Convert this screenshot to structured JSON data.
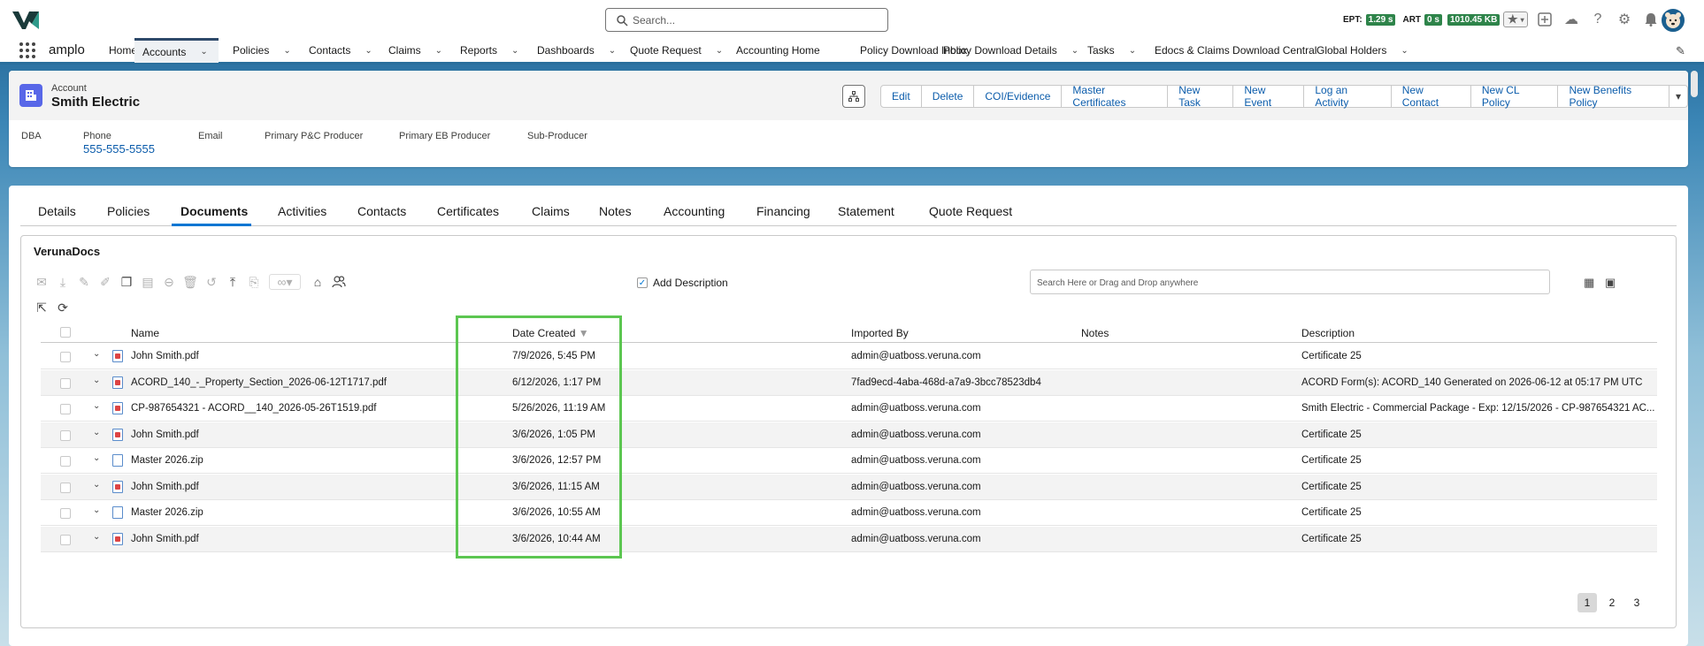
{
  "header": {
    "search_placeholder": "Search...",
    "metrics": [
      {
        "label": "EPT:",
        "value": "1.29 s"
      },
      {
        "label": "ART",
        "value": "0 s"
      },
      {
        "label": "",
        "value": "1010.45 KB"
      }
    ],
    "icons": [
      "plus-icon",
      "cloud-icon",
      "help-icon",
      "gear-icon",
      "bell-icon"
    ]
  },
  "nav": {
    "app_name": "amplo",
    "items": [
      {
        "label": "Home",
        "chevron": false
      },
      {
        "label": "Accounts",
        "chevron": true,
        "active": true
      },
      {
        "label": "Policies",
        "chevron": true
      },
      {
        "label": "Contacts",
        "chevron": true
      },
      {
        "label": "Claims",
        "chevron": true
      },
      {
        "label": "Reports",
        "chevron": true
      },
      {
        "label": "Dashboards",
        "chevron": true
      },
      {
        "label": "Quote Request",
        "chevron": true
      },
      {
        "label": "Accounting Home",
        "chevron": false
      },
      {
        "label": "Policy Download Inbox",
        "chevron": false
      },
      {
        "label": "Policy Download Details",
        "chevron": true
      },
      {
        "label": "Tasks",
        "chevron": true
      },
      {
        "label": "Edocs & Claims Download Central",
        "chevron": false
      },
      {
        "label": "Global Holders",
        "chevron": true
      }
    ]
  },
  "account": {
    "type_label": "Account",
    "name": "Smith Electric",
    "actions": [
      "Edit",
      "Delete",
      "COI/Evidence",
      "Master Certificates",
      "New Task",
      "New Event",
      "Log an Activity",
      "New Contact",
      "New CL Policy",
      "New Benefits Policy"
    ],
    "fields": {
      "dba": "DBA",
      "phone_label": "Phone",
      "phone_value": "555-555-5555",
      "email": "Email",
      "pc_producer": "Primary P&C Producer",
      "eb_producer": "Primary EB Producer",
      "sub_producer": "Sub-Producer"
    }
  },
  "tabs": [
    "Details",
    "Policies",
    "Documents",
    "Activities",
    "Contacts",
    "Certificates",
    "Claims",
    "Notes",
    "Accounting",
    "Financing",
    "Statement",
    "Quote Request"
  ],
  "active_tab": "Documents",
  "docs": {
    "title": "VerunaDocs",
    "add_description_label": "Add Description",
    "add_description_checked": true,
    "search_placeholder": "Search Here or Drag and Drop anywhere",
    "columns": {
      "name": "Name",
      "date_created": "Date Created",
      "imported_by": "Imported By",
      "notes": "Notes",
      "description": "Description"
    },
    "rows": [
      {
        "name": "John Smith.pdf",
        "type": "pdf",
        "date": "7/9/2026, 5:45 PM",
        "imported_by": "admin@uatboss.veruna.com",
        "notes": "",
        "description": "Certificate 25"
      },
      {
        "name": "ACORD_140_-_Property_Section_2026-06-12T1717.pdf",
        "type": "pdf",
        "date": "6/12/2026, 1:17 PM",
        "imported_by": "7fad9ecd-4aba-468d-a7a9-3bcc78523db4",
        "notes": "",
        "description": "ACORD Form(s): ACORD_140 Generated on 2026-06-12 at 05:17 PM UTC"
      },
      {
        "name": "CP-987654321 - ACORD__140_2026-05-26T1519.pdf",
        "type": "pdf",
        "date": "5/26/2026, 11:19 AM",
        "imported_by": "admin@uatboss.veruna.com",
        "notes": "",
        "description": "Smith Electric - Commercial Package - Exp: 12/15/2026 - CP-987654321 AC..."
      },
      {
        "name": "John Smith.pdf",
        "type": "pdf",
        "date": "3/6/2026, 1:05 PM",
        "imported_by": "admin@uatboss.veruna.com",
        "notes": "",
        "description": "Certificate 25"
      },
      {
        "name": "Master 2026.zip",
        "type": "zip",
        "date": "3/6/2026, 12:57 PM",
        "imported_by": "admin@uatboss.veruna.com",
        "notes": "",
        "description": "Certificate 25"
      },
      {
        "name": "John Smith.pdf",
        "type": "pdf",
        "date": "3/6/2026, 11:15 AM",
        "imported_by": "admin@uatboss.veruna.com",
        "notes": "",
        "description": "Certificate 25"
      },
      {
        "name": "Master 2026.zip",
        "type": "zip",
        "date": "3/6/2026, 10:55 AM",
        "imported_by": "admin@uatboss.veruna.com",
        "notes": "",
        "description": "Certificate 25"
      },
      {
        "name": "John Smith.pdf",
        "type": "pdf",
        "date": "3/6/2026, 10:44 AM",
        "imported_by": "admin@uatboss.veruna.com",
        "notes": "",
        "description": "Certificate 25"
      }
    ],
    "pages": [
      "1",
      "2",
      "3"
    ],
    "current_page": "1"
  },
  "colors": {
    "accent": "#0176d3",
    "link": "#0b5cab",
    "highlight": "#5cc651",
    "badge": "#2e844a"
  }
}
